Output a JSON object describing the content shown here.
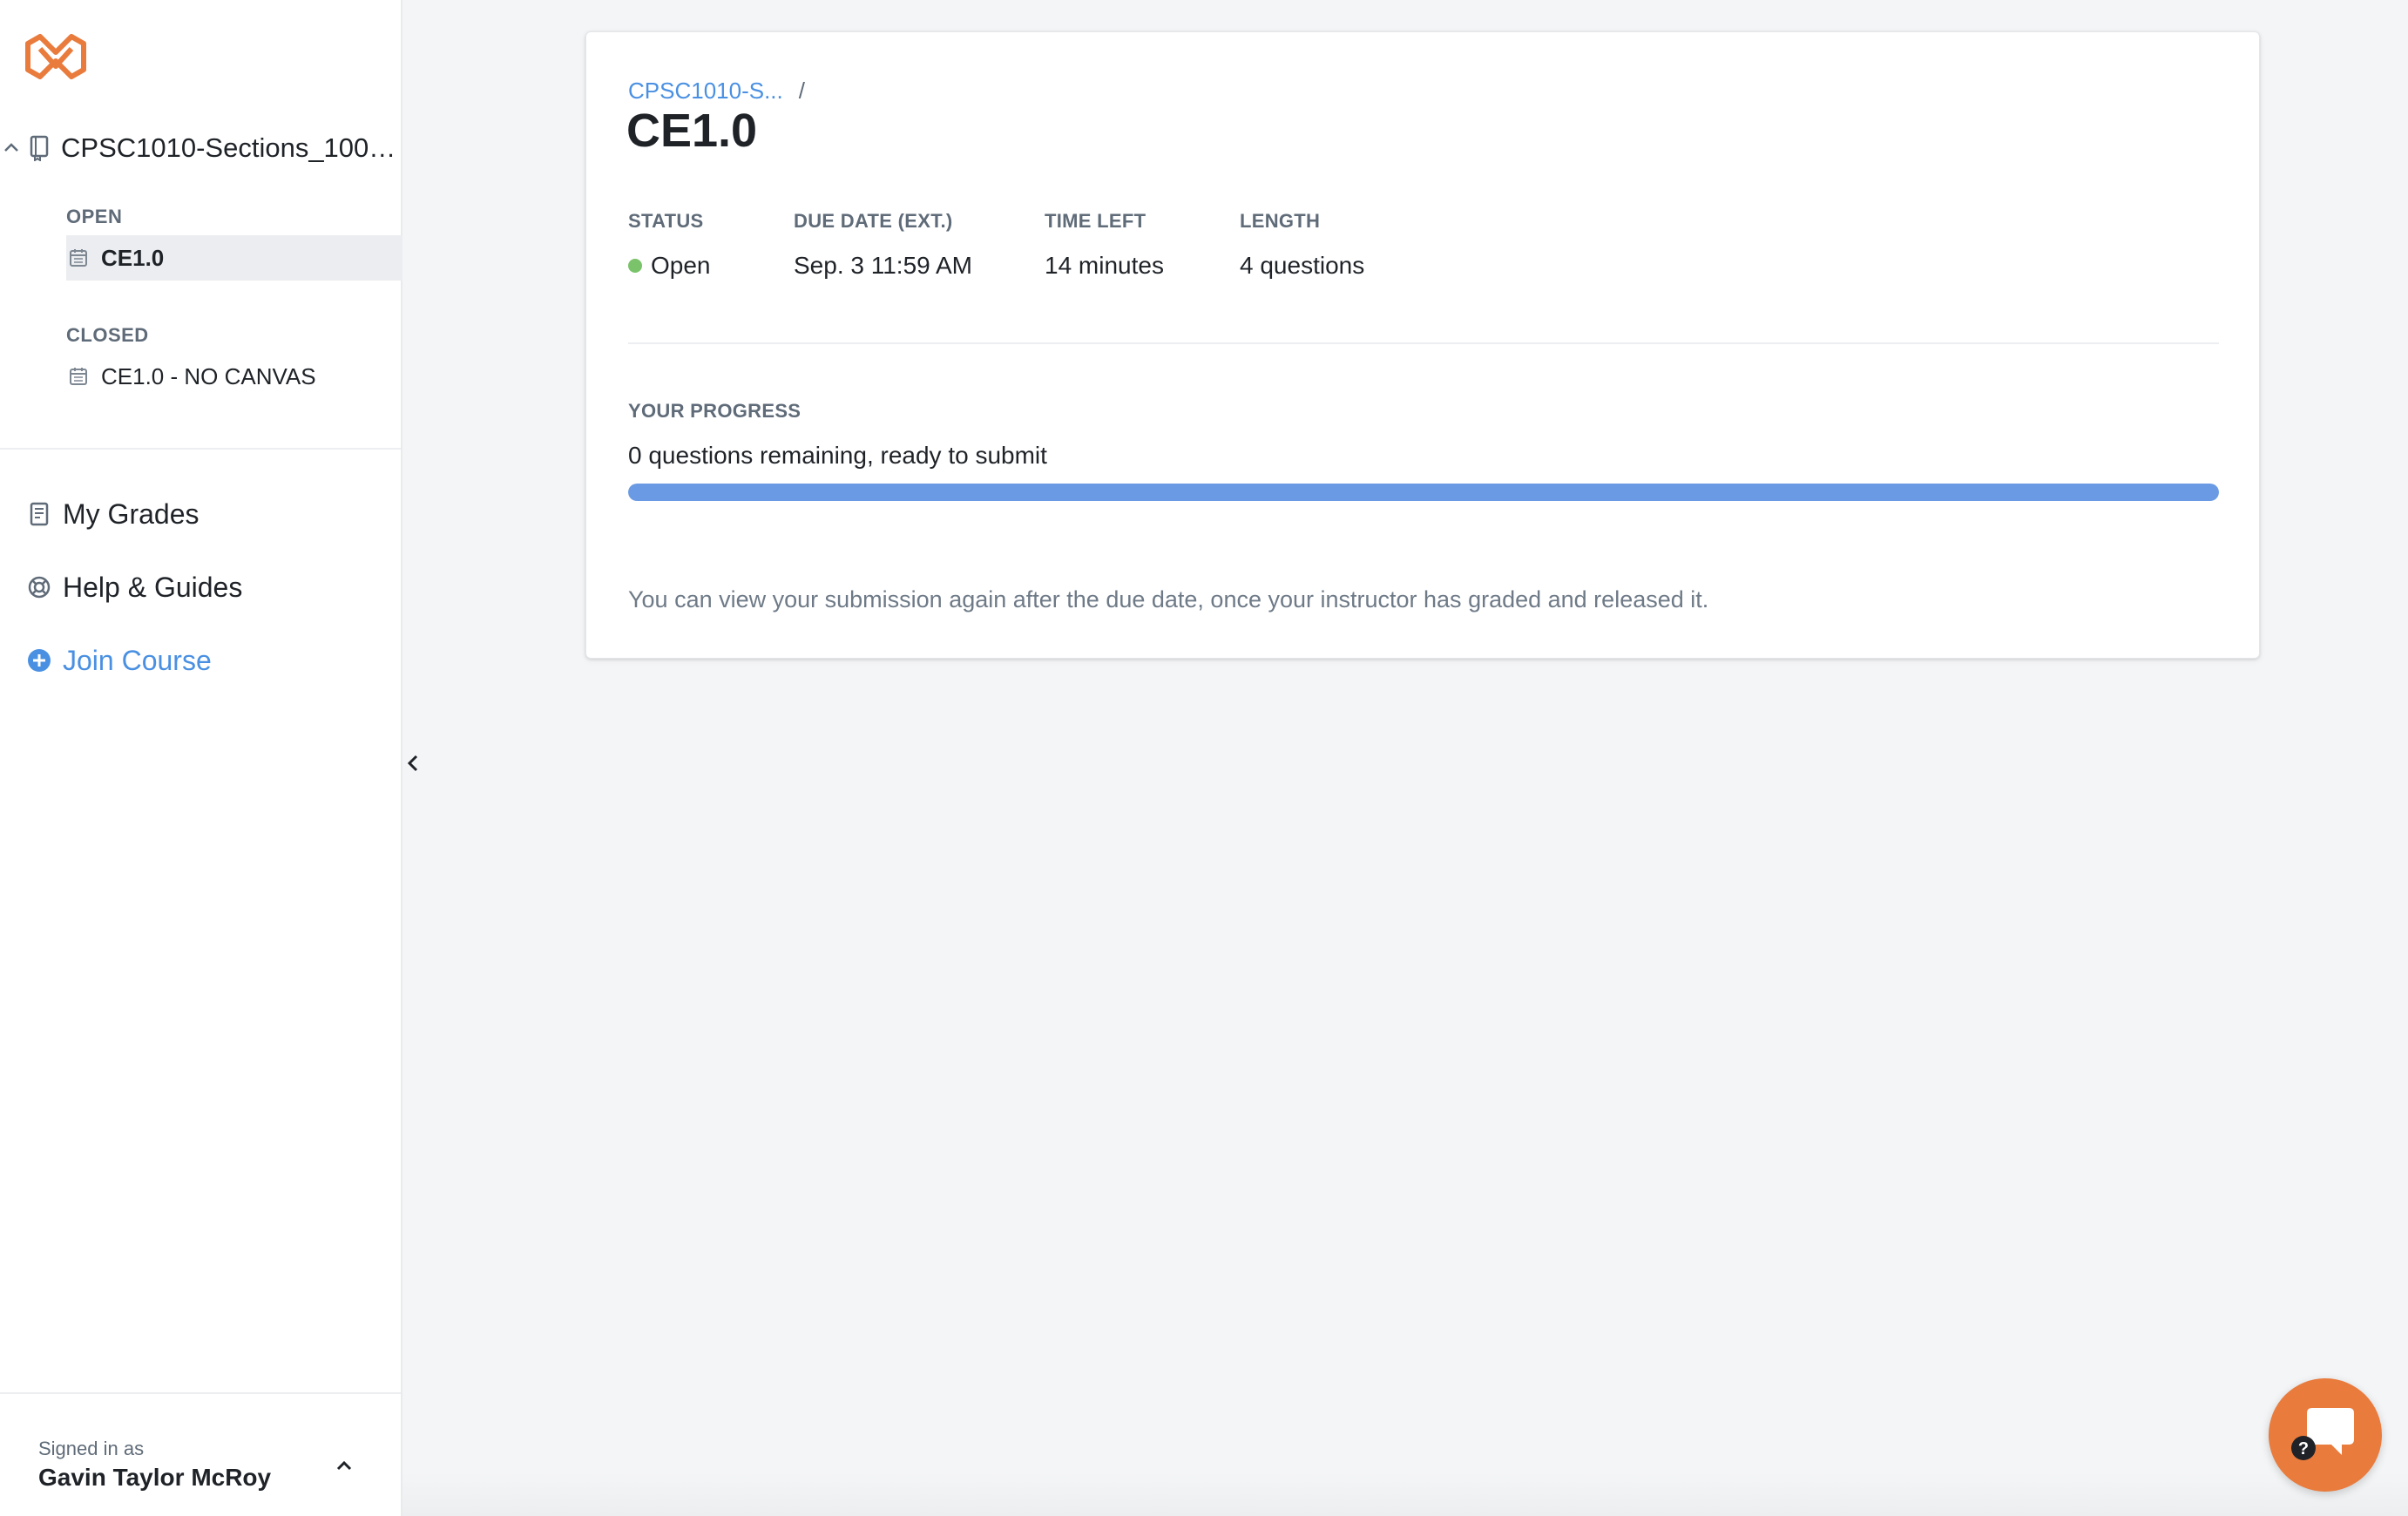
{
  "sidebar": {
    "course": {
      "name": "CPSC1010-Sections_100_..."
    },
    "groups": {
      "open": {
        "label": "OPEN",
        "items": [
          {
            "name": "CE1.0"
          }
        ]
      },
      "closed": {
        "label": "CLOSED",
        "items": [
          {
            "name": "CE1.0 - NO CANVAS"
          }
        ]
      }
    },
    "nav": {
      "grades": "My Grades",
      "help": "Help & Guides",
      "join": "Join Course"
    },
    "footer": {
      "signed_in_label": "Signed in as",
      "user_name": "Gavin Taylor McRoy"
    }
  },
  "main": {
    "breadcrumb": {
      "course": "CPSC1010-S...",
      "separator": "/"
    },
    "title": "CE1.0",
    "meta": {
      "status": {
        "label": "STATUS",
        "value": "Open"
      },
      "due": {
        "label": "DUE DATE (EXT.)",
        "value": "Sep. 3 11:59 AM"
      },
      "time_left": {
        "label": "TIME LEFT",
        "value": "14 minutes"
      },
      "length": {
        "label": "LENGTH",
        "value": "4 questions"
      }
    },
    "progress": {
      "label": "YOUR PROGRESS",
      "text": "0 questions remaining, ready to submit",
      "fraction": 1.0
    },
    "note": "You can view your submission again after the due date, once your instructor has graded and released it."
  },
  "colors": {
    "accent": "#4a90e2",
    "brand": "#e97b3c",
    "status_open": "#7ac36a",
    "progress_fill": "#6a9ae4"
  },
  "icons": {
    "logo": "brand-logo-icon",
    "course": "book-icon",
    "assignment": "calendar-icon",
    "grades": "gradebook-icon",
    "help": "lifebuoy-icon",
    "join": "plus-circle-icon",
    "chat": "chat-help-icon"
  }
}
